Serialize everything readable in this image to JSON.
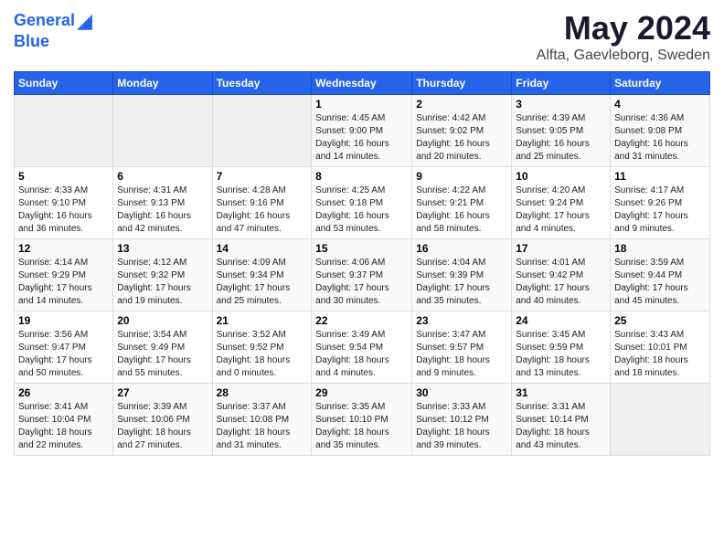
{
  "header": {
    "logo_line1": "General",
    "logo_line2": "Blue",
    "title": "May 2024",
    "location": "Alfta, Gaevleborg, Sweden"
  },
  "days_of_week": [
    "Sunday",
    "Monday",
    "Tuesday",
    "Wednesday",
    "Thursday",
    "Friday",
    "Saturday"
  ],
  "weeks": [
    [
      {
        "day": "",
        "info": ""
      },
      {
        "day": "",
        "info": ""
      },
      {
        "day": "",
        "info": ""
      },
      {
        "day": "1",
        "info": "Sunrise: 4:45 AM\nSunset: 9:00 PM\nDaylight: 16 hours\nand 14 minutes."
      },
      {
        "day": "2",
        "info": "Sunrise: 4:42 AM\nSunset: 9:02 PM\nDaylight: 16 hours\nand 20 minutes."
      },
      {
        "day": "3",
        "info": "Sunrise: 4:39 AM\nSunset: 9:05 PM\nDaylight: 16 hours\nand 25 minutes."
      },
      {
        "day": "4",
        "info": "Sunrise: 4:36 AM\nSunset: 9:08 PM\nDaylight: 16 hours\nand 31 minutes."
      }
    ],
    [
      {
        "day": "5",
        "info": "Sunrise: 4:33 AM\nSunset: 9:10 PM\nDaylight: 16 hours\nand 36 minutes."
      },
      {
        "day": "6",
        "info": "Sunrise: 4:31 AM\nSunset: 9:13 PM\nDaylight: 16 hours\nand 42 minutes."
      },
      {
        "day": "7",
        "info": "Sunrise: 4:28 AM\nSunset: 9:16 PM\nDaylight: 16 hours\nand 47 minutes."
      },
      {
        "day": "8",
        "info": "Sunrise: 4:25 AM\nSunset: 9:18 PM\nDaylight: 16 hours\nand 53 minutes."
      },
      {
        "day": "9",
        "info": "Sunrise: 4:22 AM\nSunset: 9:21 PM\nDaylight: 16 hours\nand 58 minutes."
      },
      {
        "day": "10",
        "info": "Sunrise: 4:20 AM\nSunset: 9:24 PM\nDaylight: 17 hours\nand 4 minutes."
      },
      {
        "day": "11",
        "info": "Sunrise: 4:17 AM\nSunset: 9:26 PM\nDaylight: 17 hours\nand 9 minutes."
      }
    ],
    [
      {
        "day": "12",
        "info": "Sunrise: 4:14 AM\nSunset: 9:29 PM\nDaylight: 17 hours\nand 14 minutes."
      },
      {
        "day": "13",
        "info": "Sunrise: 4:12 AM\nSunset: 9:32 PM\nDaylight: 17 hours\nand 19 minutes."
      },
      {
        "day": "14",
        "info": "Sunrise: 4:09 AM\nSunset: 9:34 PM\nDaylight: 17 hours\nand 25 minutes."
      },
      {
        "day": "15",
        "info": "Sunrise: 4:06 AM\nSunset: 9:37 PM\nDaylight: 17 hours\nand 30 minutes."
      },
      {
        "day": "16",
        "info": "Sunrise: 4:04 AM\nSunset: 9:39 PM\nDaylight: 17 hours\nand 35 minutes."
      },
      {
        "day": "17",
        "info": "Sunrise: 4:01 AM\nSunset: 9:42 PM\nDaylight: 17 hours\nand 40 minutes."
      },
      {
        "day": "18",
        "info": "Sunrise: 3:59 AM\nSunset: 9:44 PM\nDaylight: 17 hours\nand 45 minutes."
      }
    ],
    [
      {
        "day": "19",
        "info": "Sunrise: 3:56 AM\nSunset: 9:47 PM\nDaylight: 17 hours\nand 50 minutes."
      },
      {
        "day": "20",
        "info": "Sunrise: 3:54 AM\nSunset: 9:49 PM\nDaylight: 17 hours\nand 55 minutes."
      },
      {
        "day": "21",
        "info": "Sunrise: 3:52 AM\nSunset: 9:52 PM\nDaylight: 18 hours\nand 0 minutes."
      },
      {
        "day": "22",
        "info": "Sunrise: 3:49 AM\nSunset: 9:54 PM\nDaylight: 18 hours\nand 4 minutes."
      },
      {
        "day": "23",
        "info": "Sunrise: 3:47 AM\nSunset: 9:57 PM\nDaylight: 18 hours\nand 9 minutes."
      },
      {
        "day": "24",
        "info": "Sunrise: 3:45 AM\nSunset: 9:59 PM\nDaylight: 18 hours\nand 13 minutes."
      },
      {
        "day": "25",
        "info": "Sunrise: 3:43 AM\nSunset: 10:01 PM\nDaylight: 18 hours\nand 18 minutes."
      }
    ],
    [
      {
        "day": "26",
        "info": "Sunrise: 3:41 AM\nSunset: 10:04 PM\nDaylight: 18 hours\nand 22 minutes."
      },
      {
        "day": "27",
        "info": "Sunrise: 3:39 AM\nSunset: 10:06 PM\nDaylight: 18 hours\nand 27 minutes."
      },
      {
        "day": "28",
        "info": "Sunrise: 3:37 AM\nSunset: 10:08 PM\nDaylight: 18 hours\nand 31 minutes."
      },
      {
        "day": "29",
        "info": "Sunrise: 3:35 AM\nSunset: 10:10 PM\nDaylight: 18 hours\nand 35 minutes."
      },
      {
        "day": "30",
        "info": "Sunrise: 3:33 AM\nSunset: 10:12 PM\nDaylight: 18 hours\nand 39 minutes."
      },
      {
        "day": "31",
        "info": "Sunrise: 3:31 AM\nSunset: 10:14 PM\nDaylight: 18 hours\nand 43 minutes."
      },
      {
        "day": "",
        "info": ""
      }
    ]
  ]
}
